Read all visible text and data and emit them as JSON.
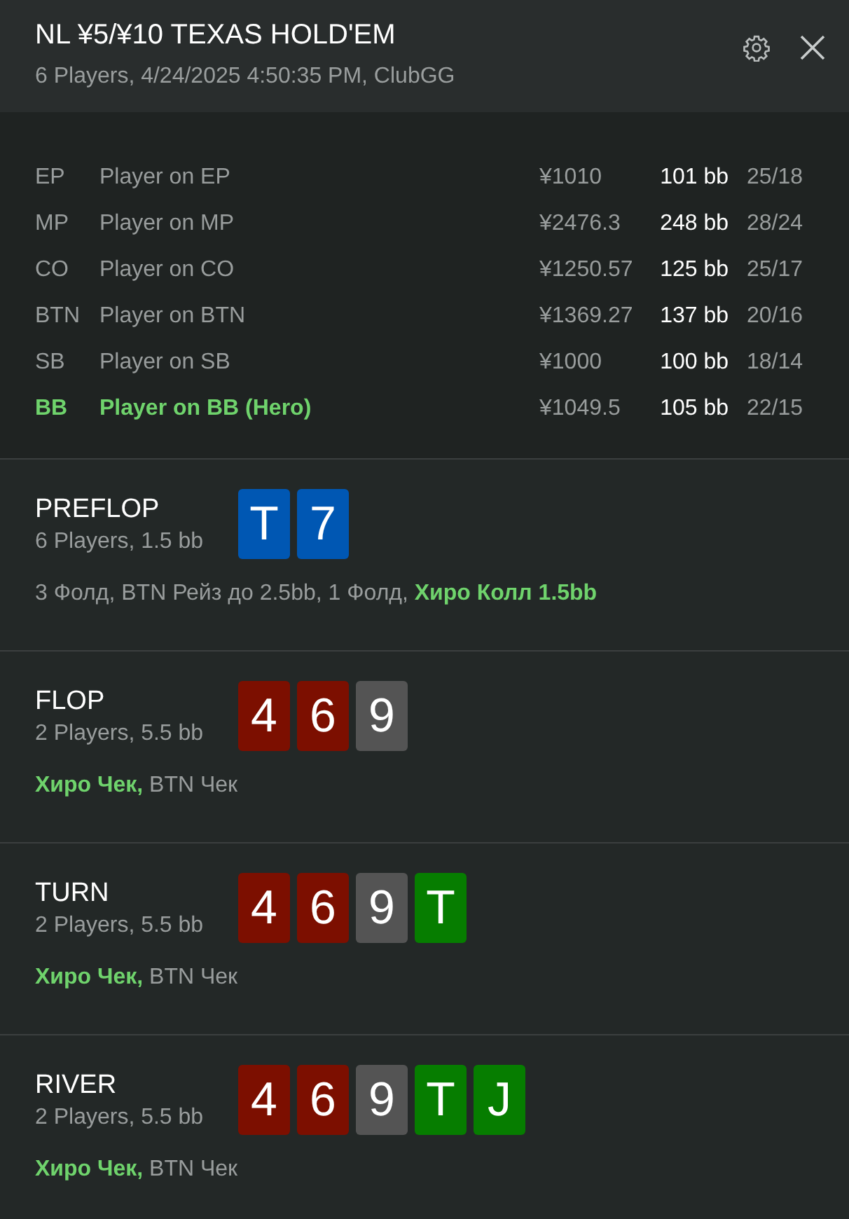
{
  "header": {
    "title": "NL ¥5/¥10 TEXAS HOLD'EM",
    "subtitle": "6 Players, 4/24/2025 4:50:35 PM, ClubGG"
  },
  "players": [
    {
      "position": "EP",
      "name": "Player on EP",
      "stack": "¥1010",
      "bb": "101 bb",
      "stats": "25/18",
      "hero": false
    },
    {
      "position": "MP",
      "name": "Player on MP",
      "stack": "¥2476.3",
      "bb": "248 bb",
      "stats": "28/24",
      "hero": false
    },
    {
      "position": "CO",
      "name": "Player on CO",
      "stack": "¥1250.57",
      "bb": "125 bb",
      "stats": "25/17",
      "hero": false
    },
    {
      "position": "BTN",
      "name": "Player on BTN",
      "stack": "¥1369.27",
      "bb": "137 bb",
      "stats": "20/16",
      "hero": false
    },
    {
      "position": "SB",
      "name": "Player on SB",
      "stack": "¥1000",
      "bb": "100 bb",
      "stats": "18/14",
      "hero": false
    },
    {
      "position": "BB",
      "name": "Player on BB (Hero)",
      "stack": "¥1049.5",
      "bb": "105 bb",
      "stats": "22/15",
      "hero": true
    }
  ],
  "streets": [
    {
      "name": "PREFLOP",
      "info": "6 Players, 1.5 bb",
      "cards": [
        {
          "rank": "T",
          "color": "#0057b3"
        },
        {
          "rank": "7",
          "color": "#0057b3"
        }
      ],
      "actions": [
        {
          "text": "3 Фолд, BTN Рейз до 2.5bb, 1 Фолд, ",
          "hero": false
        },
        {
          "text": "Хиро Колл 1.5bb",
          "hero": true
        }
      ]
    },
    {
      "name": "FLOP",
      "info": "2 Players, 5.5 bb",
      "cards": [
        {
          "rank": "4",
          "color": "#7c0f00"
        },
        {
          "rank": "6",
          "color": "#7c0f00"
        },
        {
          "rank": "9",
          "color": "#545454"
        }
      ],
      "actions": [
        {
          "text": "Хиро Чек,",
          "hero": true
        },
        {
          "text": " BTN Чек",
          "hero": false
        }
      ]
    },
    {
      "name": "TURN",
      "info": "2 Players, 5.5 bb",
      "cards": [
        {
          "rank": "4",
          "color": "#7c0f00"
        },
        {
          "rank": "6",
          "color": "#7c0f00"
        },
        {
          "rank": "9",
          "color": "#545454"
        },
        {
          "rank": "T",
          "color": "#067d00"
        }
      ],
      "actions": [
        {
          "text": "Хиро Чек,",
          "hero": true
        },
        {
          "text": " BTN Чек",
          "hero": false
        }
      ]
    },
    {
      "name": "RIVER",
      "info": "2 Players, 5.5 bb",
      "cards": [
        {
          "rank": "4",
          "color": "#7c0f00"
        },
        {
          "rank": "6",
          "color": "#7c0f00"
        },
        {
          "rank": "9",
          "color": "#545454"
        },
        {
          "rank": "T",
          "color": "#067d00"
        },
        {
          "rank": "J",
          "color": "#067d00"
        }
      ],
      "actions": [
        {
          "text": "Хиро Чек,",
          "hero": true
        },
        {
          "text": " BTN Чек",
          "hero": false
        }
      ]
    }
  ]
}
